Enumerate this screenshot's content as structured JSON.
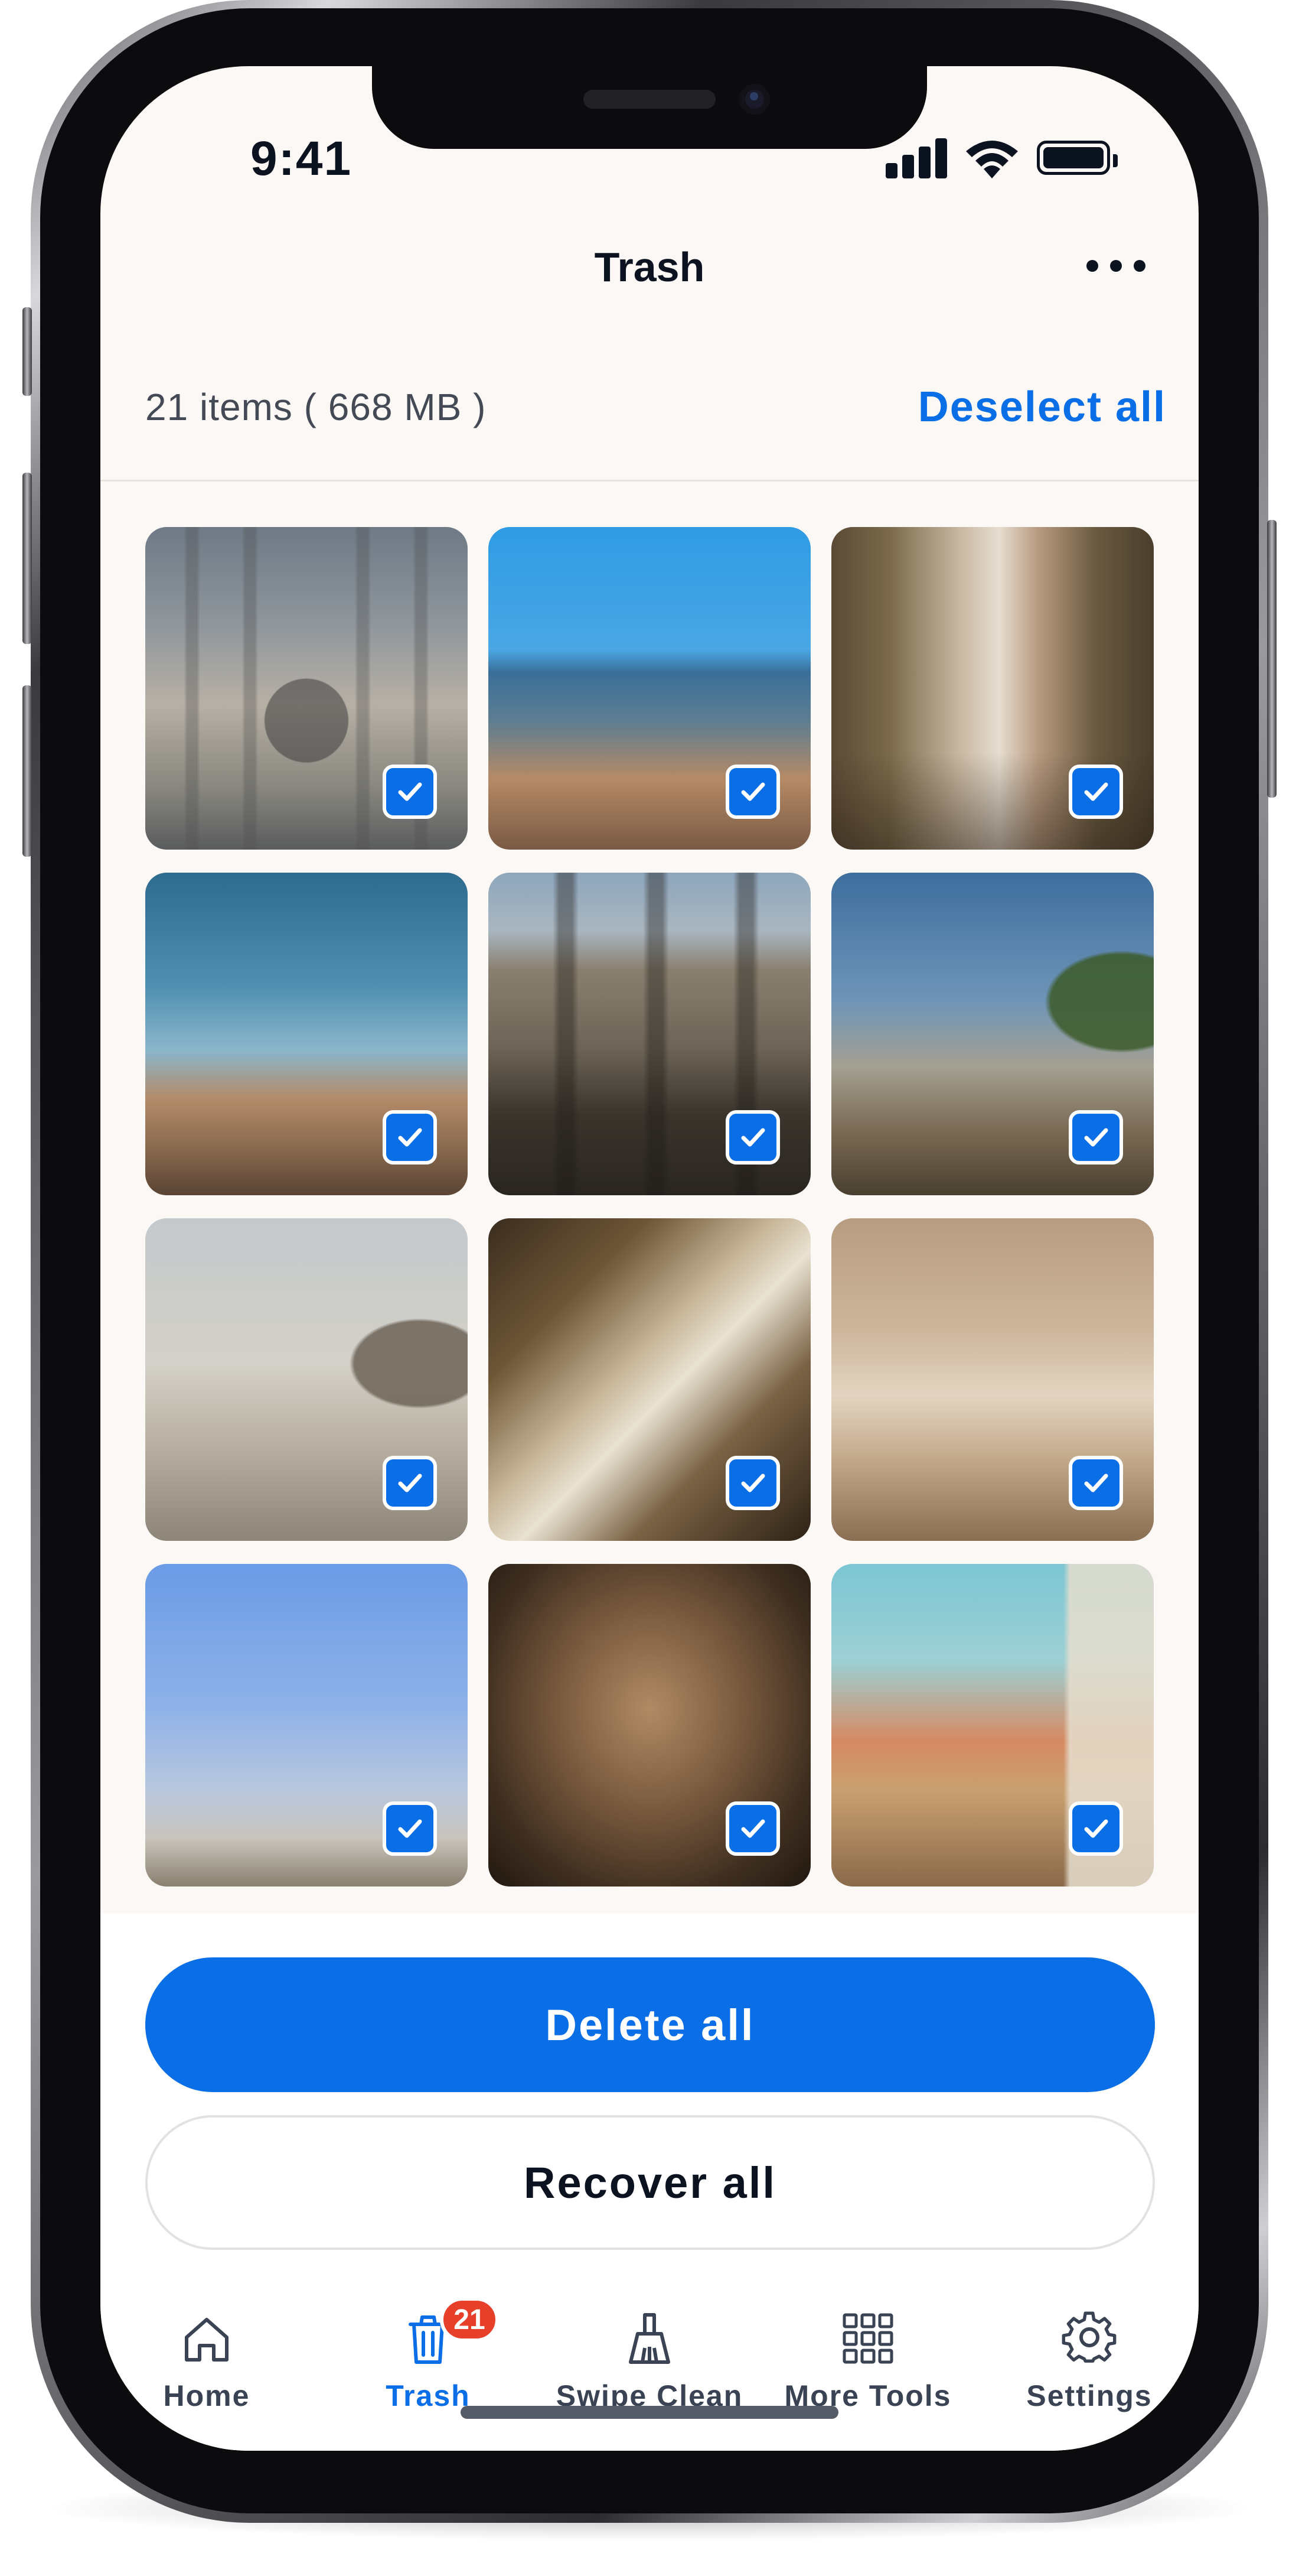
{
  "status_bar": {
    "time": "9:41"
  },
  "header": {
    "title": "Trash",
    "more_icon": "ellipsis-icon"
  },
  "summary": {
    "text": "21 items ( 668 MB )",
    "deselect_label": "Deselect all"
  },
  "photos": [
    {
      "name": "fountain facade",
      "selected": true
    },
    {
      "name": "city skyline",
      "selected": true
    },
    {
      "name": "narrow street",
      "selected": true
    },
    {
      "name": "forum ruins",
      "selected": true
    },
    {
      "name": "pantheon",
      "selected": true
    },
    {
      "name": "colosseum",
      "selected": true
    },
    {
      "name": "hazy skyline urn",
      "selected": true
    },
    {
      "name": "basilica interior",
      "selected": true
    },
    {
      "name": "fountain statues",
      "selected": true
    },
    {
      "name": "dome at dusk",
      "selected": true
    },
    {
      "name": "frescoed ceiling",
      "selected": true
    },
    {
      "name": "colorful buildings",
      "selected": true
    }
  ],
  "actions": {
    "delete_label": "Delete all",
    "recover_label": "Recover all"
  },
  "tabs": [
    {
      "label": "Home",
      "icon": "home-icon",
      "active": false
    },
    {
      "label": "Trash",
      "icon": "trash-icon",
      "active": true,
      "badge": "21"
    },
    {
      "label": "Swipe Clean",
      "icon": "broom-icon",
      "active": false
    },
    {
      "label": "More Tools",
      "icon": "grid-icon",
      "active": false
    },
    {
      "label": "Settings",
      "icon": "gear-icon",
      "active": false
    }
  ],
  "colors": {
    "accent": "#0a6ee6",
    "badge": "#e7402a",
    "background": "#fcf8f5",
    "text": "#0c1320"
  }
}
